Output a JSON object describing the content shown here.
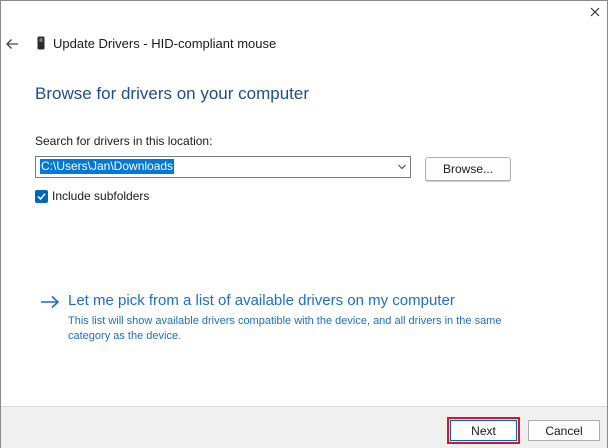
{
  "window": {
    "title": "Update Drivers - HID-compliant mouse",
    "back_icon": "back-arrow-icon",
    "close_icon": "close-icon",
    "device_icon": "mouse-device-icon"
  },
  "main": {
    "heading": "Browse for drivers on your computer",
    "search_label": "Search for drivers in this location:",
    "path_value": "C:\\Users\\Jan\\Downloads",
    "browse_label": "Browse...",
    "include_subfolders_label": "Include subfolders",
    "include_subfolders_checked": true
  },
  "pick_link": {
    "title": "Let me pick from a list of available drivers on my computer",
    "description": "This list will show available drivers compatible with the device, and all drivers in the same category as the device."
  },
  "footer": {
    "next_label": "Next",
    "cancel_label": "Cancel"
  },
  "colors": {
    "heading": "#1f4e8c",
    "link": "#1d6fc4",
    "selection": "#0078d7",
    "checkbox": "#0067c0",
    "highlight": "#e0141e"
  }
}
